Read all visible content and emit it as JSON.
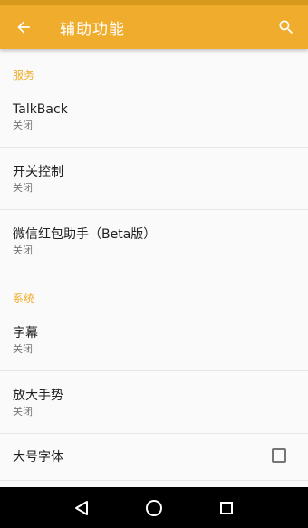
{
  "appbar": {
    "title": "辅助功能",
    "back_icon": "arrow-back-icon",
    "search_icon": "search-icon",
    "color": "#f0ad2d"
  },
  "sections": [
    {
      "header": "服务",
      "items": [
        {
          "title": "TalkBack",
          "summary": "关闭"
        },
        {
          "title": "开关控制",
          "summary": "关闭"
        },
        {
          "title": "微信红包助手（Beta版）",
          "summary": "关闭"
        }
      ]
    },
    {
      "header": "系统",
      "items": [
        {
          "title": "字幕",
          "summary": "关闭"
        },
        {
          "title": "放大手势",
          "summary": "关闭"
        },
        {
          "title": "大号字体",
          "checked": false
        }
      ]
    }
  ],
  "navbar": {
    "back_icon": "nav-back-triangle-icon",
    "home_icon": "nav-home-circle-icon",
    "recents_icon": "nav-recents-square-icon"
  }
}
